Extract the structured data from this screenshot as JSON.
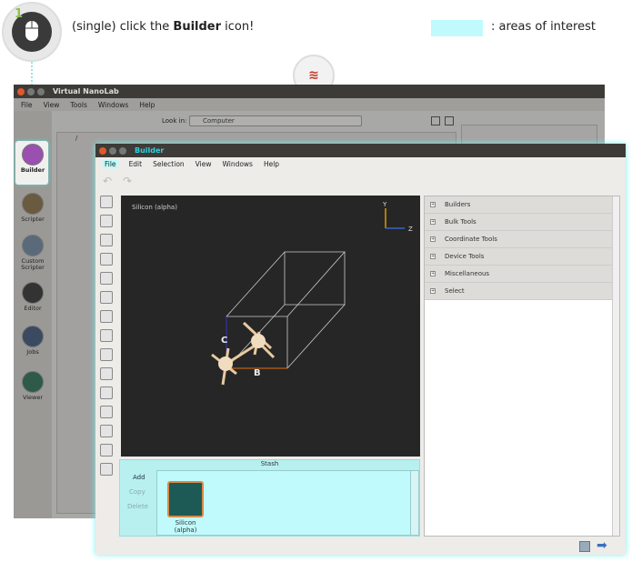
{
  "instruction": {
    "step": "1",
    "prefix": "(single) click the ",
    "target": "Builder",
    "suffix": " icon!"
  },
  "legend": {
    "text": ": areas of interest",
    "color": "#c0fafc"
  },
  "back_window": {
    "title": "Virtual NanoLab",
    "menu": [
      "File",
      "View",
      "Tools",
      "Windows",
      "Help"
    ],
    "look_in_label": "Look in:",
    "look_in_value": "Computer",
    "path": "/",
    "left_panel": [
      "Builder",
      "Scripter",
      "Custom Scripter",
      "Editor",
      "Jobs",
      "Viewer"
    ]
  },
  "builder": {
    "title": "Builder",
    "menu": [
      "File",
      "Edit",
      "Selection",
      "View",
      "Windows",
      "Help"
    ],
    "viewport_label": "Silicon (alpha)",
    "axes": {
      "y": "Y",
      "z": "Z",
      "c": "C",
      "b": "B"
    },
    "sections": [
      "Builders",
      "Bulk Tools",
      "Coordinate Tools",
      "Device Tools",
      "Miscellaneous",
      "Select"
    ],
    "stash": {
      "title": "Stash",
      "buttons": [
        "Add",
        "Copy",
        "Delete"
      ],
      "item": "Silicon (alpha)",
      "item_line1": "Silicon",
      "item_line2": "(alpha)"
    }
  }
}
